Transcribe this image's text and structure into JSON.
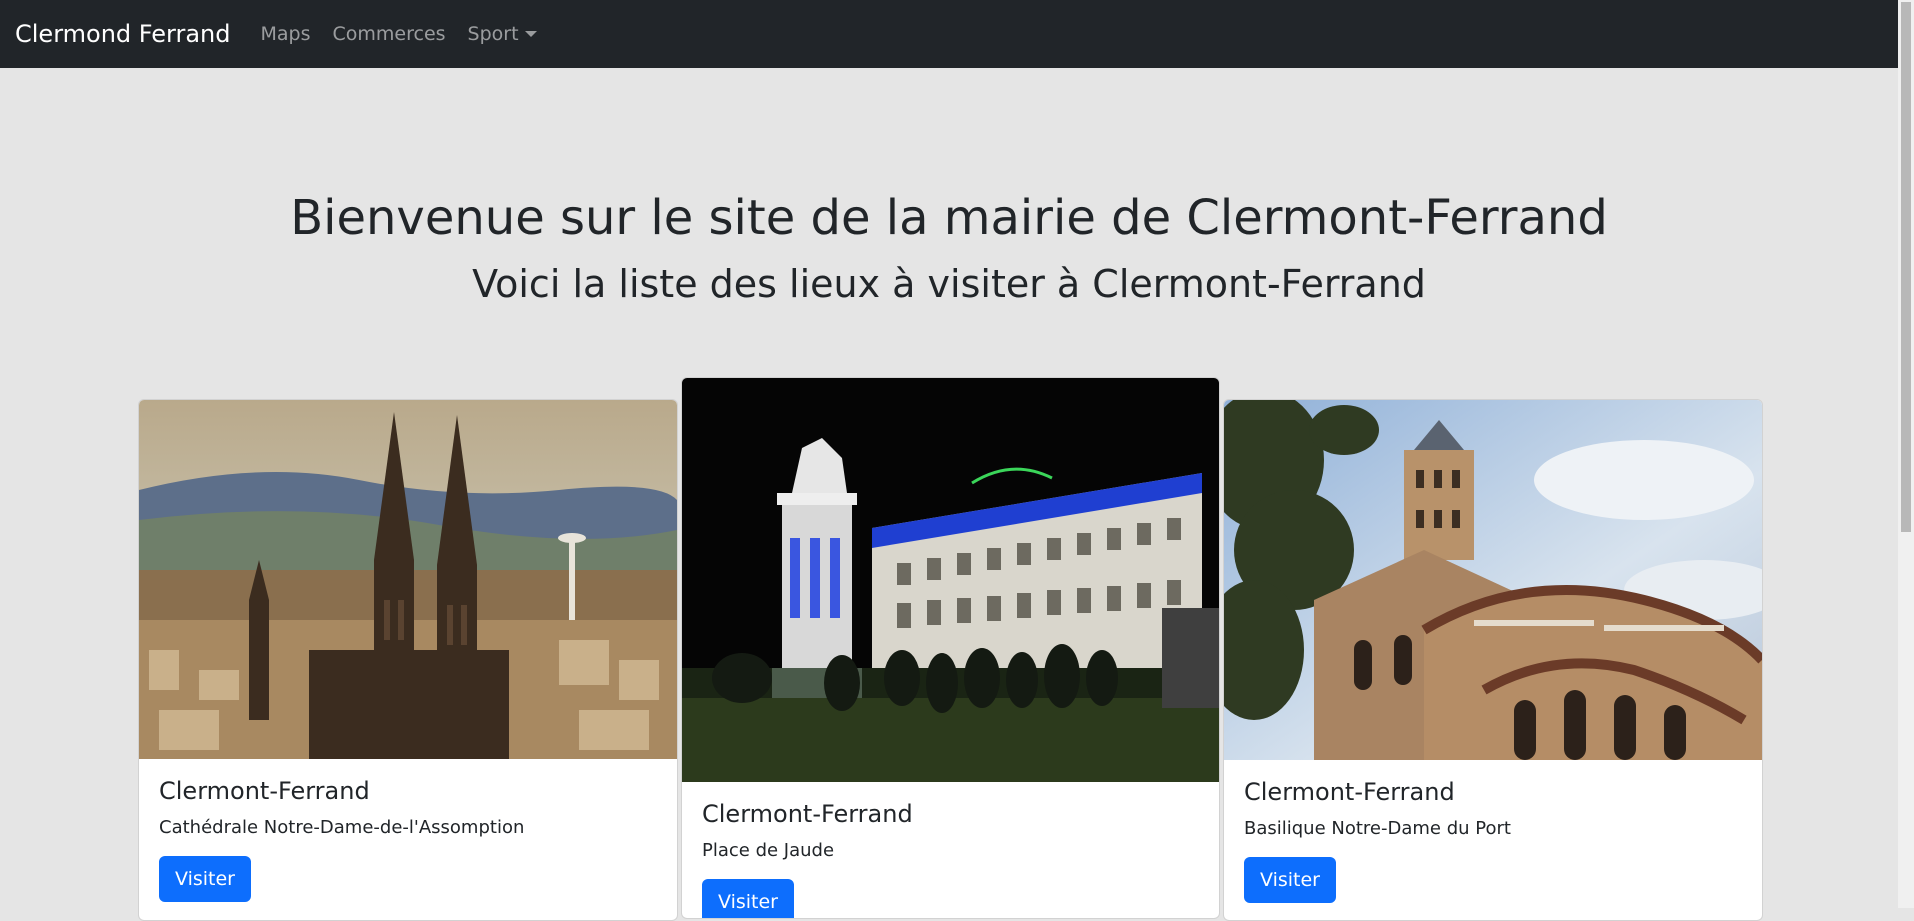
{
  "navbar": {
    "brand": "Clermond Ferrand",
    "links": [
      "Maps",
      "Commerces",
      "Sport"
    ]
  },
  "hero": {
    "title": "Bienvenue sur le site de la mairie de Clermont-Ferrand",
    "subtitle": "Voici la liste des lieux à visiter à Clermont-Ferrand"
  },
  "cards": [
    {
      "title": "Clermont-Ferrand",
      "text": "Cathédrale Notre-Dame-de-l'Assomption",
      "button": "Visiter"
    },
    {
      "title": "Clermont-Ferrand",
      "text": "Place de Jaude",
      "button": "Visiter"
    },
    {
      "title": "Clermont-Ferrand",
      "text": "Basilique Notre-Dame du Port",
      "button": "Visiter"
    }
  ],
  "colors": {
    "navbar_bg": "#212529",
    "page_bg": "#e5e5e5",
    "primary": "#0d6efd"
  }
}
